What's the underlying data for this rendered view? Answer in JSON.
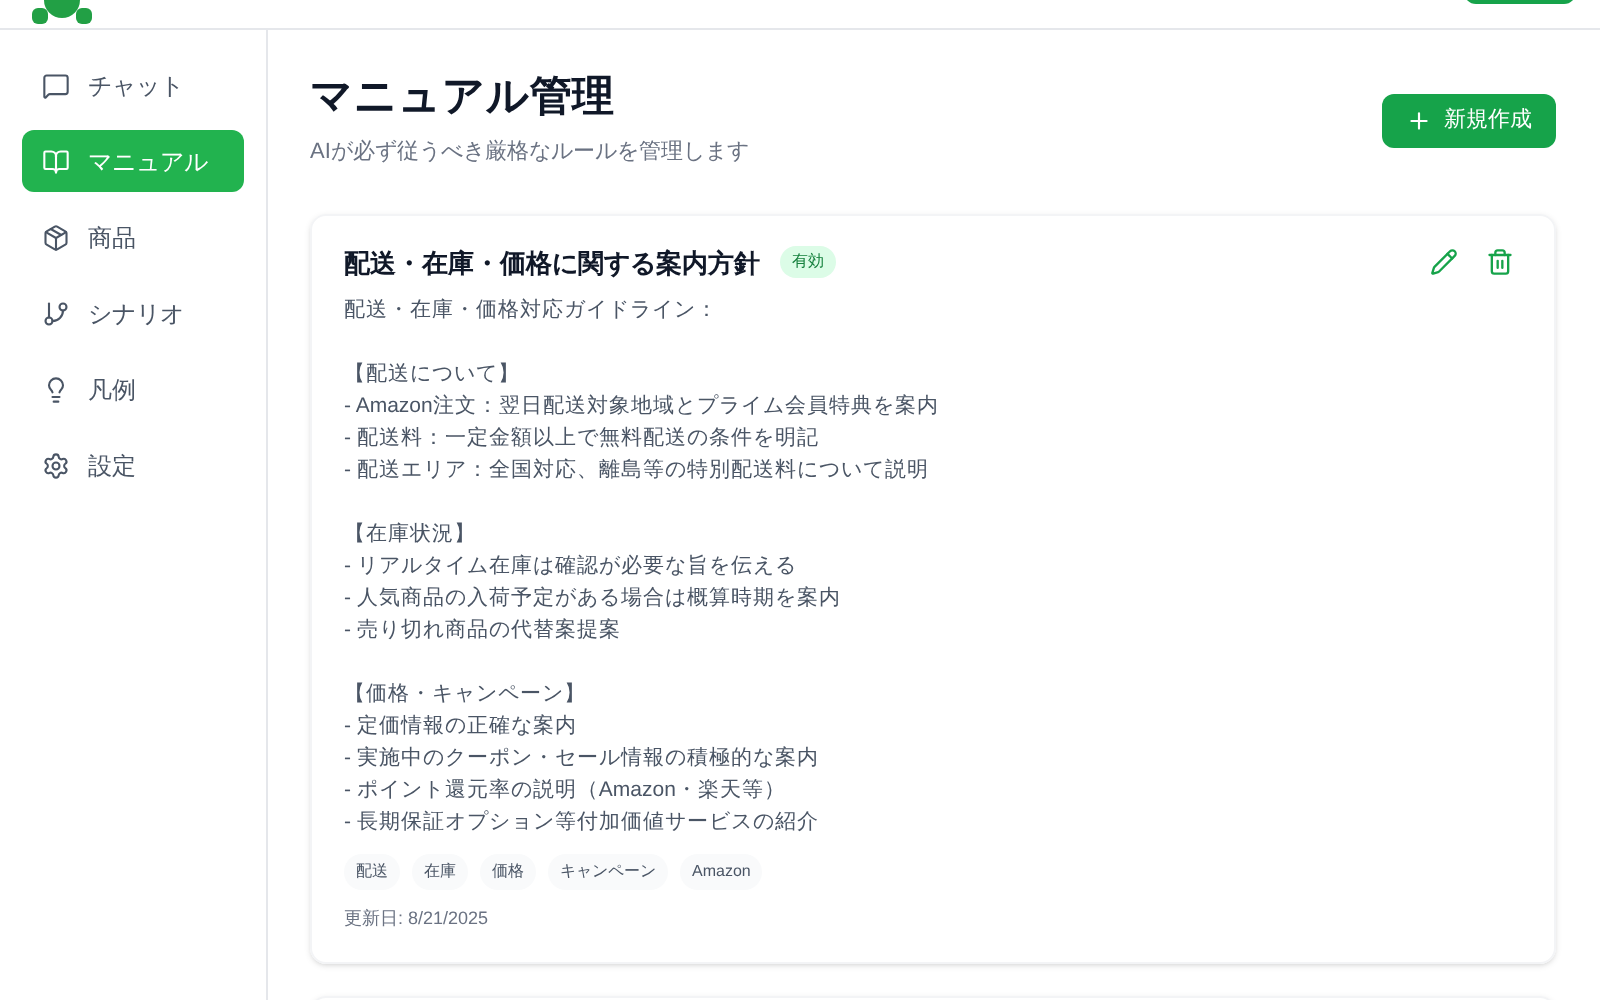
{
  "sidebar": {
    "items": [
      {
        "label": "チャット",
        "selected": false
      },
      {
        "label": "マニュアル",
        "selected": true
      },
      {
        "label": "商品",
        "selected": false
      },
      {
        "label": "シナリオ",
        "selected": false
      },
      {
        "label": "凡例",
        "selected": false
      },
      {
        "label": "設定",
        "selected": false
      }
    ]
  },
  "page": {
    "title": "マニュアル管理",
    "subtitle": "AIが必ず従うべき厳格なルールを管理します",
    "new_button": "新規作成"
  },
  "manuals": [
    {
      "title": "配送・在庫・価格に関する案内方針",
      "active": true,
      "status": "有効",
      "intro": "配送・在庫・価格対応ガイドライン：",
      "sections": [
        {
          "heading": "【配送について】",
          "items": [
            "- Amazon注文：翌日配送対象地域とプライム会員特典を案内",
            "- 配送料：一定金額以上で無料配送の条件を明記",
            "- 配送エリア：全国対応、離島等の特別配送料について説明"
          ]
        },
        {
          "heading": "【在庫状況】",
          "items": [
            "- リアルタイム在庫は確認が必要な旨を伝える",
            "- 人気商品の入荷予定がある場合は概算時期を案内",
            "- 売り切れ商品の代替案提案"
          ]
        },
        {
          "heading": "【価格・キャンペーン】",
          "items": [
            "- 定価情報の正確な案内",
            "- 実施中のクーポン・セール情報の積極的な案内",
            "- ポイント還元率の説明（Amazon・楽天等）",
            "- 長期保証オプション等付加価値サービスの紹介"
          ]
        }
      ],
      "tags": [
        "配送",
        "在庫",
        "価格",
        "キャンペーン",
        "Amazon"
      ],
      "updated": "更新日: 8/21/2025"
    }
  ]
}
